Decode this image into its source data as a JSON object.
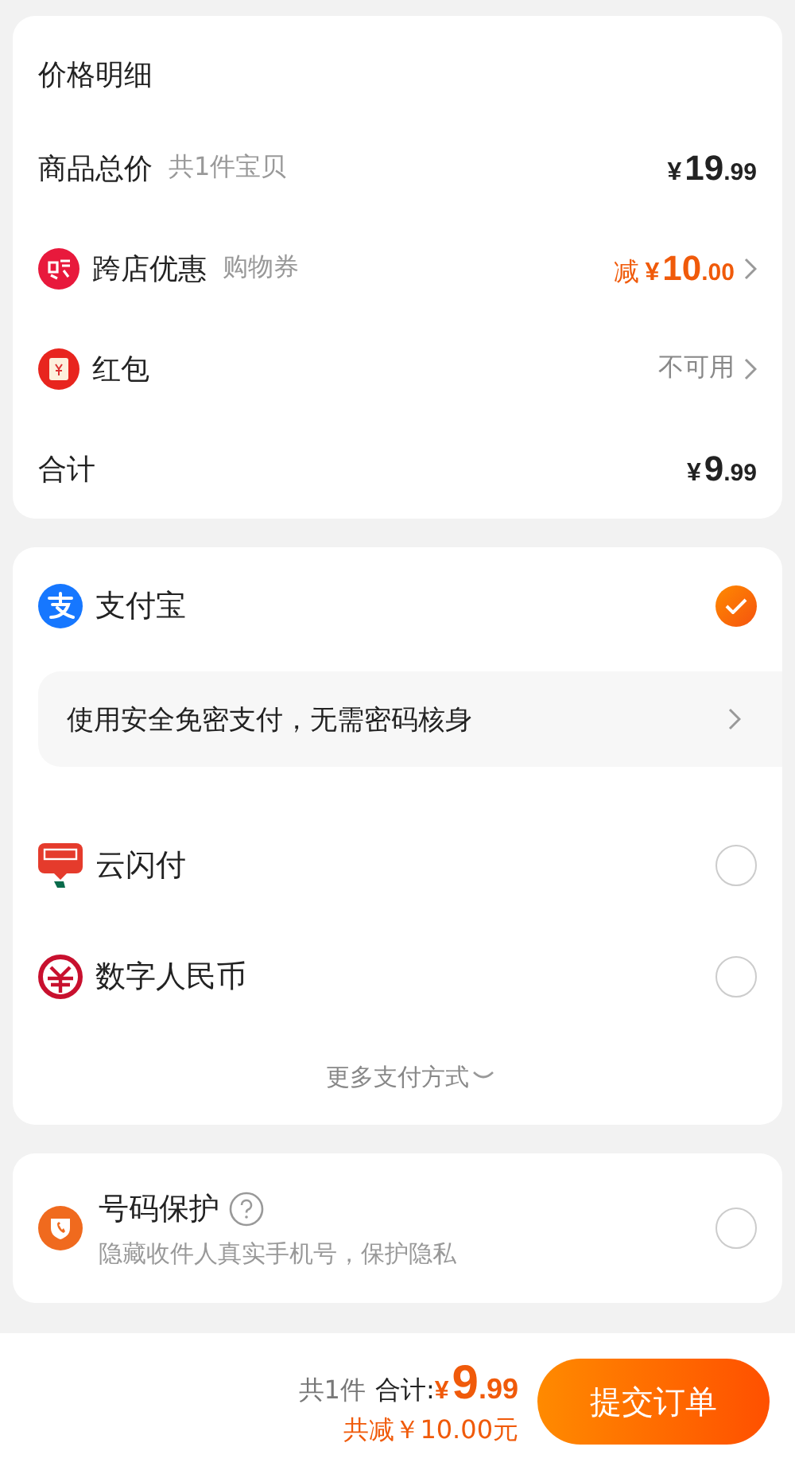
{
  "price_detail": {
    "title": "价格明细",
    "rows": [
      {
        "kind": "plain",
        "label": "商品总价",
        "sublabel": "共1件宝贝",
        "amount": {
          "currency": "¥",
          "integer": "19",
          "decimal": ".99"
        },
        "chevron": false
      },
      {
        "kind": "cross-store",
        "label": "跨店优惠",
        "sublabel": "购物券",
        "amount": {
          "prefix": "减",
          "currency": "¥",
          "integer": "10",
          "decimal": ".00"
        },
        "chevron": true
      },
      {
        "kind": "red-packet",
        "label": "红包",
        "note": "不可用",
        "chevron": true
      },
      {
        "kind": "plain",
        "label": "合计",
        "amount": {
          "currency": "¥",
          "integer": "9",
          "decimal": ".99"
        },
        "chevron": false
      }
    ]
  },
  "payment": {
    "methods": [
      {
        "kind": "alipay",
        "label": "支付宝",
        "selected": true,
        "banner": "使用安全免密支付，无需密码核身"
      },
      {
        "kind": "unionpay",
        "label": "云闪付",
        "selected": false
      },
      {
        "kind": "ecny",
        "label": "数字人民币",
        "selected": false
      }
    ],
    "more": "更多支付方式"
  },
  "number_protection": {
    "title": "号码保护",
    "description": "隐藏收件人真实手机号，保护隐私",
    "selected": false
  },
  "footer": {
    "count": "共1件",
    "total_label": "合计:",
    "currency": "¥",
    "integer": "9",
    "decimal": ".99",
    "discount": "共减￥10.00元",
    "submit": "提交订单"
  }
}
